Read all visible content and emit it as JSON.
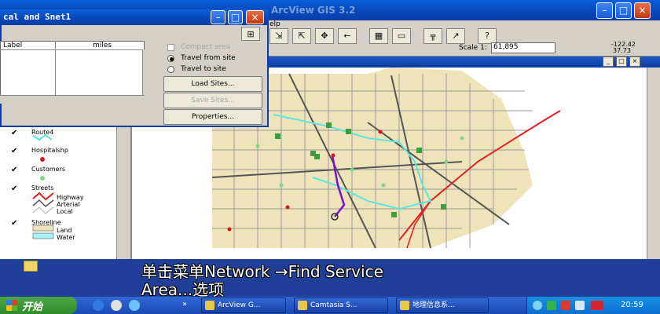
{
  "app": {
    "title": "ArcView GIS 3.2",
    "menu_fragment": "elp"
  },
  "toolbar": {
    "scale_label": "Scale 1:",
    "scale_value": "61,895",
    "coord_x": "-122.42",
    "coord_y": "37.73"
  },
  "dialog": {
    "title": "cal and Snet1",
    "table_headers": [
      "Label",
      "miles"
    ],
    "options": {
      "compact": "Compact area",
      "travel_from": "Travel from site",
      "travel_to": "Travel to site"
    },
    "buttons": {
      "load": "Load Sites...",
      "save": "Save Sites...",
      "properties": "Properties..."
    }
  },
  "legend": [
    {
      "name": "Route4"
    },
    {
      "name": "Hospitalshp"
    },
    {
      "name": "Customers"
    },
    {
      "name": "Streets",
      "items": [
        "Highway",
        "Arterial",
        "Local"
      ]
    },
    {
      "name": "Shoreline",
      "items": [
        "Land",
        "Water"
      ]
    }
  ],
  "subtitle": {
    "line1": "单击菜单Network →Find Service",
    "line2": "Area...选项"
  },
  "taskbar": {
    "start": "开始",
    "tasks": [
      "ArcView G...",
      "Camtasia S...",
      "地理信息系..."
    ],
    "clock": "20:59"
  },
  "colors": {
    "desktop": "#3a6ea5",
    "water": "#a9f3f6",
    "land": "#efe3ba",
    "route": "#7b0fc9",
    "hospital": "#d8141e",
    "customer": "#7cd787",
    "highway": "#e02020"
  }
}
